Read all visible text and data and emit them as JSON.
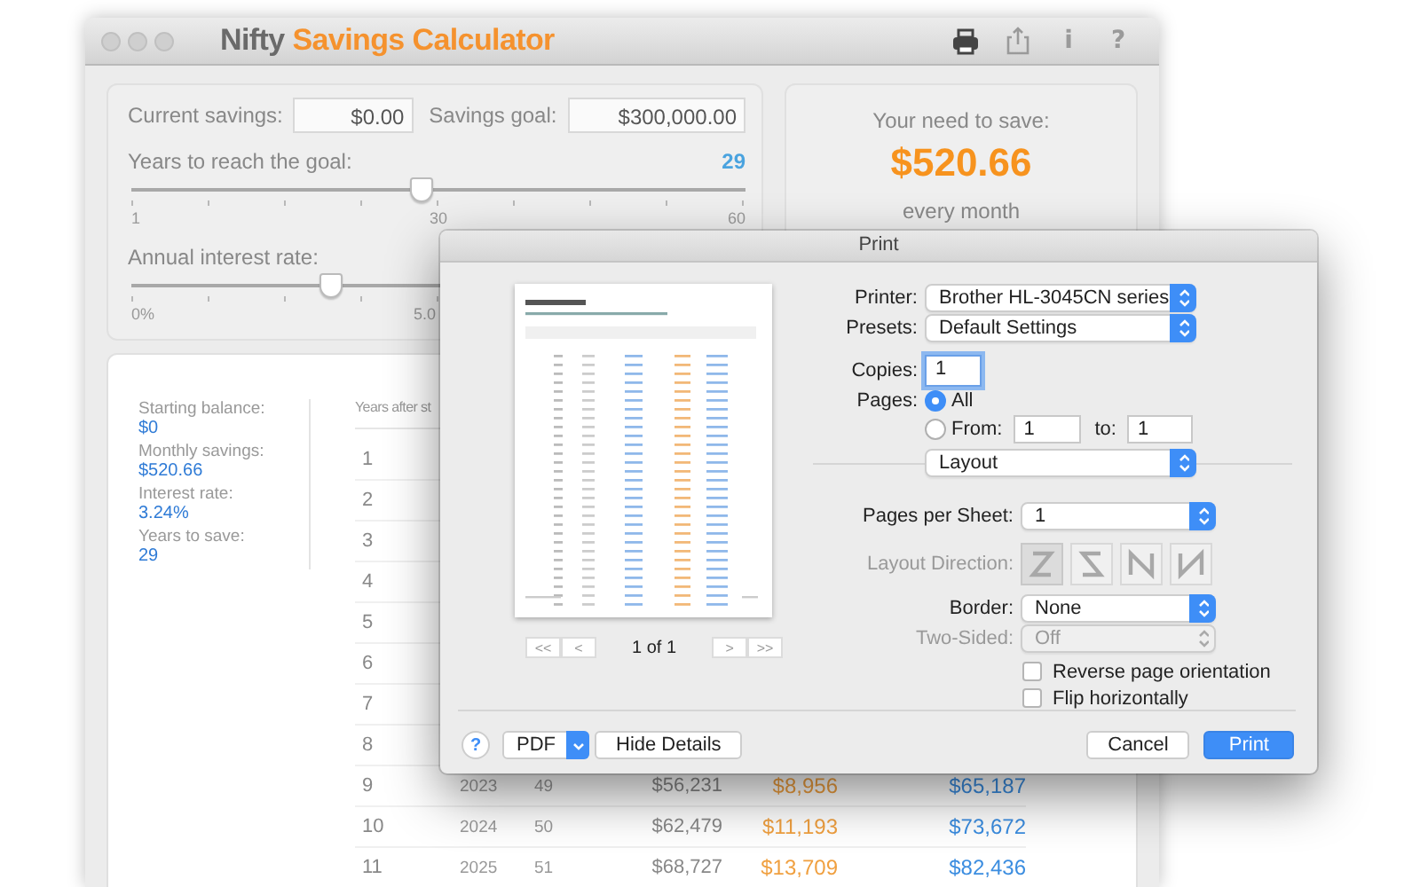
{
  "window": {
    "title": {
      "brand": "Nifty",
      "name": "Savings Calculator"
    },
    "toolbar": [
      {
        "kind": "print",
        "disabled": false
      },
      {
        "kind": "share",
        "disabled": true
      },
      {
        "kind": "glyph",
        "glyph": "i",
        "disabled": true
      },
      {
        "kind": "glyph",
        "glyph": "?",
        "disabled": true
      }
    ]
  },
  "inputs": [
    {
      "label": "Current savings:",
      "value": "$0.00"
    },
    {
      "label": "Savings goal:",
      "value": "$300,000.00"
    }
  ],
  "years_slider": {
    "label": "Years to reach the goal:",
    "reading": "29",
    "level": 0.47,
    "ticks": [
      "1",
      "30",
      "60"
    ]
  },
  "rate_slider": {
    "label": "Annual interest rate:",
    "level": 0.324,
    "ticks": [
      "0%",
      "5.0"
    ]
  },
  "result": {
    "caption": "Your need to save:",
    "amount": "$520.66",
    "period": "every month"
  },
  "summary": [
    {
      "label": "Starting balance:",
      "value": "$0"
    },
    {
      "label": "Monthly savings:",
      "value": "$520.66"
    },
    {
      "label": "Interest rate:",
      "value": "3.24%"
    },
    {
      "label": "Years to save:",
      "value": "29"
    }
  ],
  "table": {
    "columns": [
      "Years after st"
    ],
    "rows": [
      {
        "cells": [
          "1"
        ]
      },
      {
        "cells": [
          "2"
        ]
      },
      {
        "cells": [
          "3"
        ]
      },
      {
        "cells": [
          "4"
        ]
      },
      {
        "cells": [
          "5"
        ]
      },
      {
        "cells": [
          "6"
        ]
      },
      {
        "cells": [
          "7"
        ]
      },
      {
        "cells": [
          "8"
        ]
      },
      {
        "cells": [
          "9",
          "2023",
          "49",
          "$56,231",
          "$8,956",
          "$65,187"
        ]
      },
      {
        "cells": [
          "10",
          "2024",
          "50",
          "$62,479",
          "$11,193",
          "$73,672"
        ]
      },
      {
        "cells": [
          "11",
          "2025",
          "51",
          "$68,727",
          "$13,709",
          "$82,436"
        ]
      }
    ]
  },
  "print_dialog": {
    "title": "Print",
    "pager": {
      "first": "<<",
      "previous": "<",
      "page": "1 of 1",
      "next": ">",
      "last": ">>"
    },
    "printer": {
      "label": "Printer:",
      "value": "Brother HL-3045CN series"
    },
    "presets": {
      "label": "Presets:",
      "value": "Default Settings"
    },
    "copies": {
      "label": "Copies:",
      "value": "1"
    },
    "pages": {
      "label": "Pages:",
      "options": [
        {
          "label": "All",
          "selected": true
        },
        {
          "label": "From:",
          "selected": false
        }
      ],
      "from": "1",
      "to_label": "to:",
      "to": "1"
    },
    "section": {
      "value": "Layout"
    },
    "pages_per_sheet": {
      "label": "Pages per Sheet:",
      "value": "1"
    },
    "layout_direction": {
      "label": "Layout Direction:",
      "disabled": true,
      "options": [
        {
          "selected": true
        },
        {
          "selected": false
        },
        {
          "selected": false
        },
        {
          "selected": false
        }
      ]
    },
    "border": {
      "label": "Border:",
      "value": "None"
    },
    "two_sided": {
      "label": "Two-Sided:",
      "value": "Off",
      "disabled": true
    },
    "checkboxes": [
      {
        "label": "Reverse page orientation",
        "checked": false
      },
      {
        "label": "Flip horizontally",
        "checked": false
      }
    ],
    "help": "?",
    "format": "PDF",
    "details_button": "Hide Details",
    "cancel": "Cancel",
    "confirm": "Print"
  }
}
